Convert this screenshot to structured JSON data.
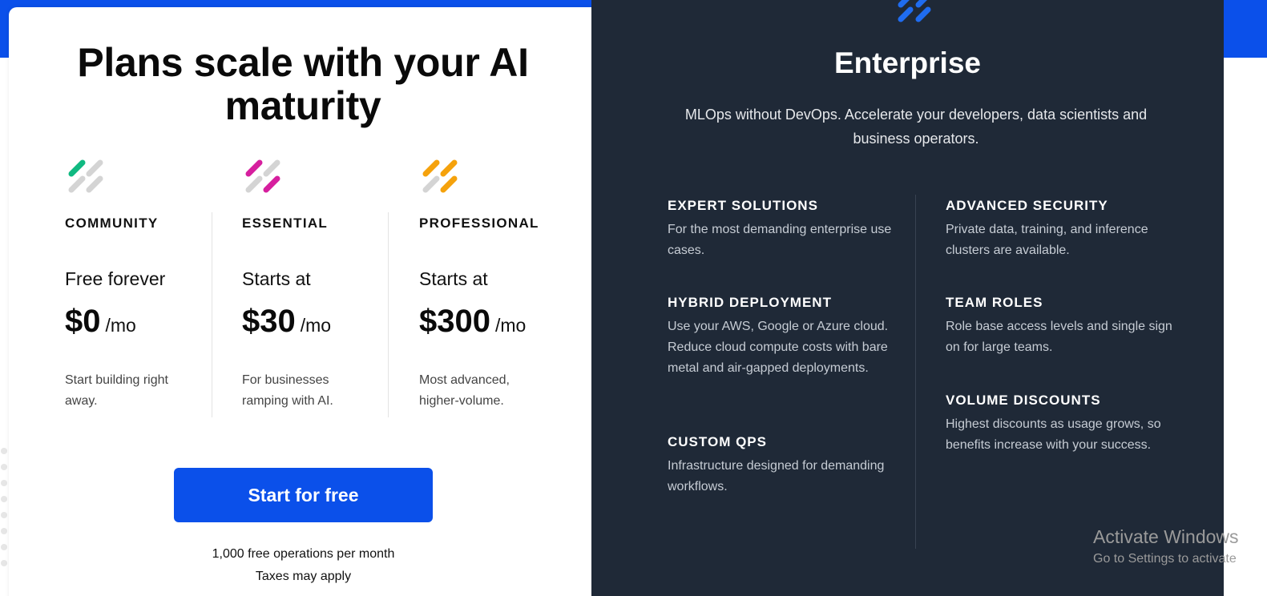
{
  "colors": {
    "brand_blue": "#0b50ea",
    "enterprise_bg": "#1f2937",
    "community_accent": "#10b981",
    "essential_accent": "#d61f9e",
    "professional_accent": "#f5a20c",
    "enterprise_accent": "#1f6cf0"
  },
  "pricing": {
    "headline": "Plans scale with your AI maturity",
    "tiers": [
      {
        "icon": "community-logo-icon",
        "name": "COMMUNITY",
        "subtitle": "Free forever",
        "price": "$0",
        "unit": "/mo",
        "description": "Start building right away."
      },
      {
        "icon": "essential-logo-icon",
        "name": "ESSENTIAL",
        "subtitle": "Starts at",
        "price": "$30",
        "unit": "/mo",
        "description": "For businesses ramping with AI."
      },
      {
        "icon": "professional-logo-icon",
        "name": "PROFESSIONAL",
        "subtitle": "Starts at",
        "price": "$300",
        "unit": "/mo",
        "description": "Most advanced, higher-volume."
      }
    ],
    "cta_label": "Start for free",
    "cta_note_1": "1,000 free operations per month",
    "cta_note_2": "Taxes may apply"
  },
  "enterprise": {
    "icon": "enterprise-logo-icon",
    "title": "Enterprise",
    "subtitle": "MLOps without DevOps. Accelerate your developers, data scientists and business operators.",
    "features": [
      {
        "title": "EXPERT SOLUTIONS",
        "desc": "For the most demanding enterprise use cases."
      },
      {
        "title": "HYBRID DEPLOYMENT",
        "desc": "Use your AWS, Google or Azure cloud. Reduce cloud compute costs with bare metal and air-gapped deployments."
      },
      {
        "title": "CUSTOM QPS",
        "desc": "Infrastructure designed for demanding workflows."
      },
      {
        "title": "ADVANCED SECURITY",
        "desc": "Private data, training, and inference clusters are available."
      },
      {
        "title": "TEAM ROLES",
        "desc": "Role base access levels and single sign on for large teams."
      },
      {
        "title": "VOLUME DISCOUNTS",
        "desc": "Highest discounts as usage grows, so benefits increase with your success."
      }
    ]
  },
  "watermark": {
    "line1": "Activate Windows",
    "line2": "Go to Settings to activate"
  }
}
